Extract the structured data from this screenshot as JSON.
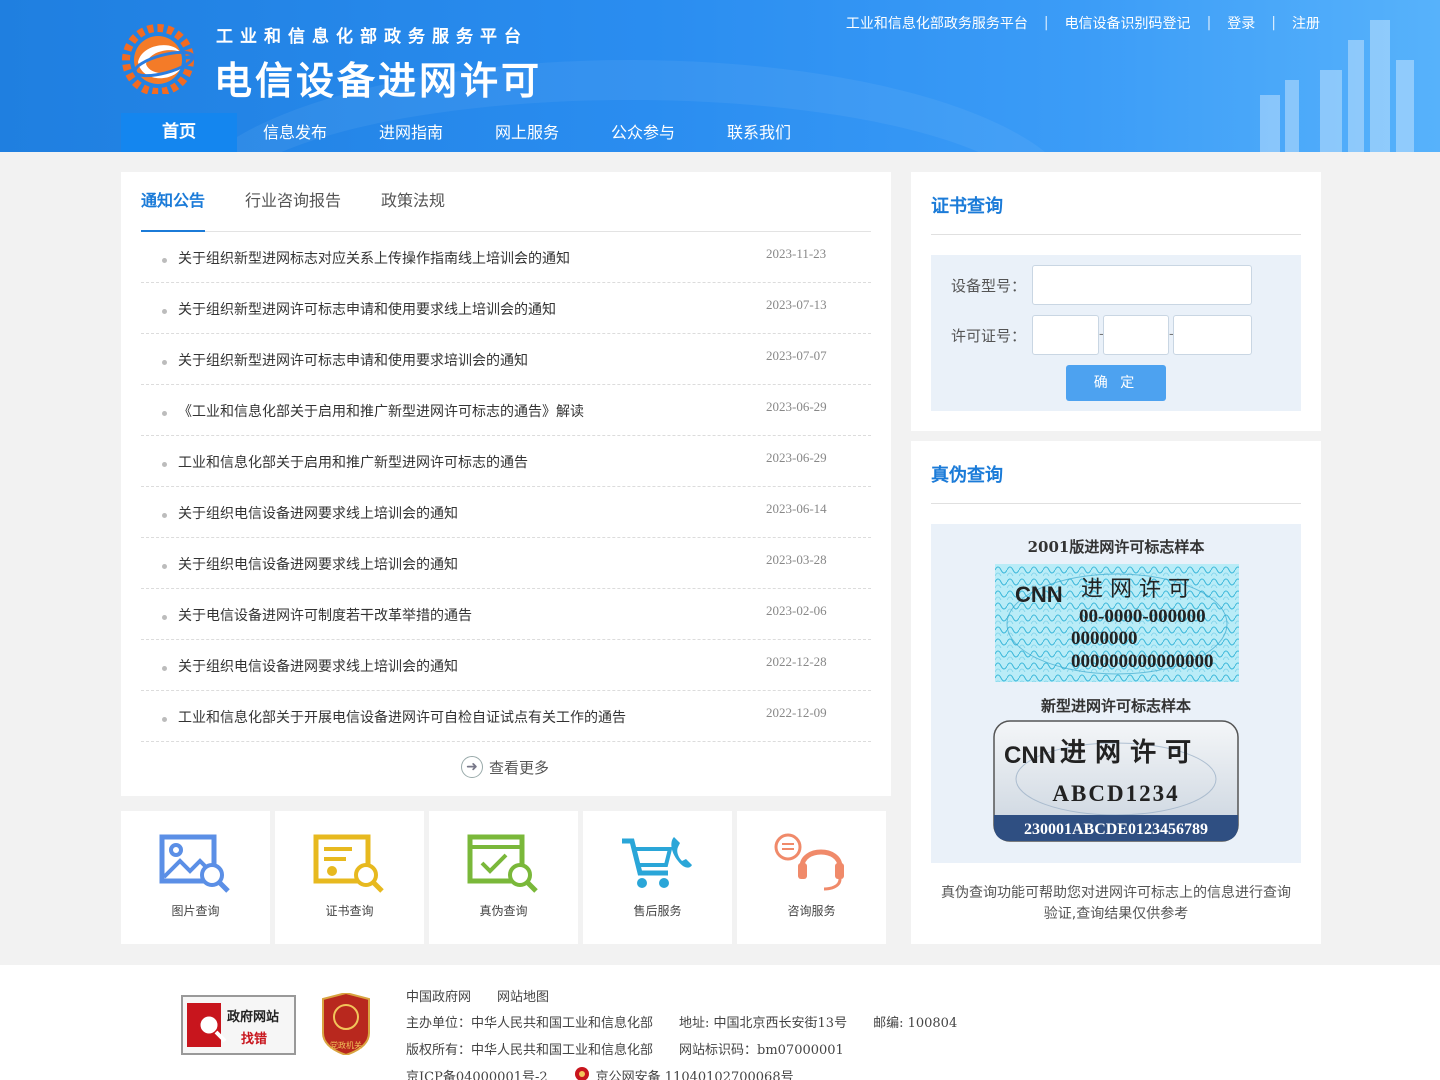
{
  "header": {
    "subtitle": "工业和信息化部政务服务平台",
    "title": "电信设备进网许可",
    "top_links": [
      "工业和信息化部政务服务平台",
      "电信设备识别码登记",
      "登录",
      "注册"
    ],
    "nav": [
      "首页",
      "信息发布",
      "进网指南",
      "网上服务",
      "公众参与",
      "联系我们"
    ]
  },
  "news": {
    "tabs": [
      "通知公告",
      "行业咨询报告",
      "政策法规"
    ],
    "items": [
      {
        "title": "关于组织新型进网标志对应关系上传操作指南线上培训会的通知",
        "date": "2023-11-23"
      },
      {
        "title": "关于组织新型进网许可标志申请和使用要求线上培训会的通知",
        "date": "2023-07-13"
      },
      {
        "title": "关于组织新型进网许可标志申请和使用要求培训会的通知",
        "date": "2023-07-07"
      },
      {
        "title": "《工业和信息化部关于启用和推广新型进网许可标志的通告》解读",
        "date": "2023-06-29"
      },
      {
        "title": "工业和信息化部关于启用和推广新型进网许可标志的通告",
        "date": "2023-06-29"
      },
      {
        "title": "关于组织电信设备进网要求线上培训会的通知",
        "date": "2023-06-14"
      },
      {
        "title": "关于组织电信设备进网要求线上培训会的通知",
        "date": "2023-03-28"
      },
      {
        "title": "关于电信设备进网许可制度若干改革举措的通告",
        "date": "2023-02-06"
      },
      {
        "title": "关于组织电信设备进网要求线上培训会的通知",
        "date": "2022-12-28"
      },
      {
        "title": "工业和信息化部关于开展电信设备进网许可自检自证试点有关工作的通告",
        "date": "2022-12-09"
      }
    ],
    "more": "查看更多"
  },
  "quick_links": [
    "图片查询",
    "证书查询",
    "真伪查询",
    "售后服务",
    "咨询服务"
  ],
  "cert_query": {
    "title": "证书查询",
    "model_label": "设备型号：",
    "license_label": "许可证号：",
    "dash": "-",
    "button": "确 定"
  },
  "auth_query": {
    "title": "真伪查询",
    "sample1_caption": "2001版进网许可标志样本",
    "sample1_header": "进 网 许 可",
    "sample1_line1": "00-0000-000000",
    "sample1_line2": "0000000",
    "sample1_line3": "000000000000000",
    "sample2_caption": "新型进网许可标志样本",
    "sample2_header": "进 网 许 可",
    "sample2_code": "ABCD1234",
    "sample2_serial": "230001ABCDE0123456789",
    "logo_text": "CNN",
    "description": "真伪查询功能可帮助您对进网许可标志上的信息进行查询验证,查询结果仅供参考"
  },
  "footer": {
    "links": [
      "中国政府网",
      "网站地图"
    ],
    "sponsor": "主办单位：中华人民共和国工业和信息化部",
    "address": "地址: 中国北京西长安街13号",
    "postcode": "邮编: 100804",
    "copyright": "版权所有：中华人民共和国工业和信息化部",
    "site_id": "网站标识码：bm07000001",
    "icp": "京ICP备04000001号-2",
    "police": "京公网安备 11040102700068号",
    "badge1_line1": "政府网站",
    "badge1_line2": "找错",
    "badge2_text": "党政机关"
  },
  "colors": {
    "primary": "#1b7bd8",
    "header_blue": "#2a8df0",
    "button": "#4da2f0"
  }
}
